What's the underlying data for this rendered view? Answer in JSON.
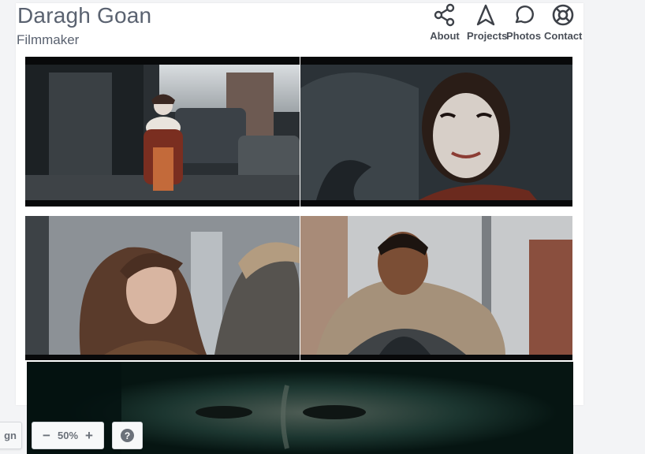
{
  "site": {
    "title": "Daragh Goan",
    "subtitle": "Filmmaker"
  },
  "nav": {
    "items": [
      {
        "label": "About",
        "icon": "share-icon"
      },
      {
        "label": "Projects",
        "icon": "navigation-arrow-icon"
      },
      {
        "label": "Photos",
        "icon": "speech-bubble-icon"
      },
      {
        "label": "Contact",
        "icon": "lifebuoy-icon"
      }
    ]
  },
  "toolbar": {
    "left_partial_label": "gn",
    "zoom_minus": "−",
    "zoom_value": "50%",
    "zoom_plus": "+",
    "help_label": "?"
  },
  "colors": {
    "text": "#5a6270",
    "nav_icon": "#3d4148",
    "page_bg": "#ffffff",
    "canvas_bg": "#f3f4f6"
  }
}
